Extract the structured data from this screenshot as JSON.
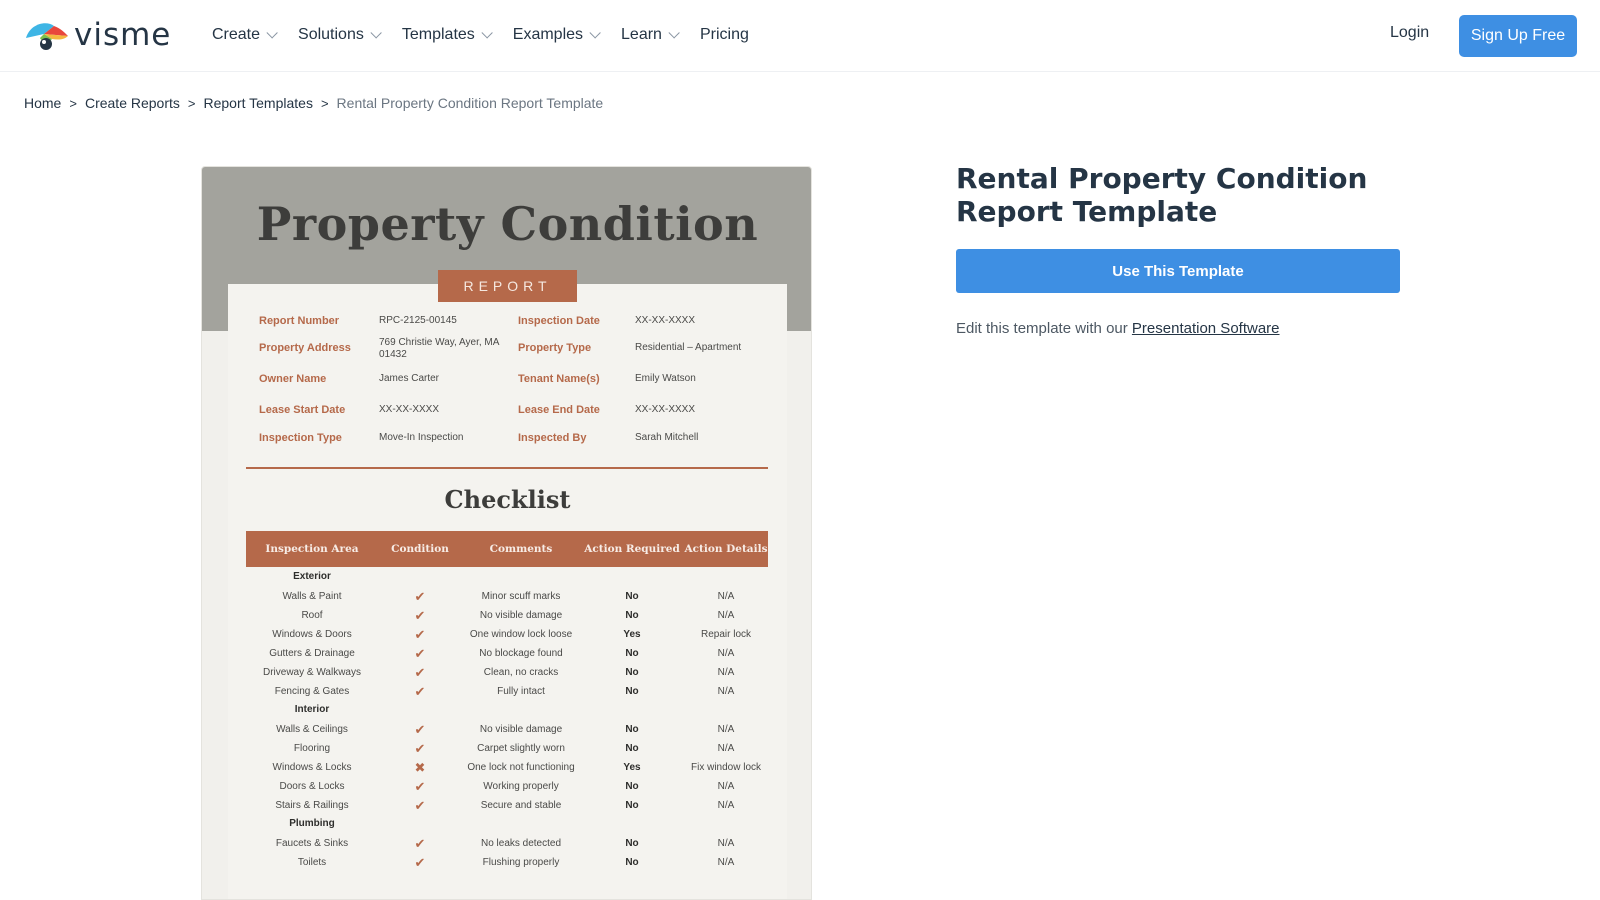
{
  "header": {
    "brand": "visme",
    "nav": [
      {
        "label": "Create",
        "dropdown": true
      },
      {
        "label": "Solutions",
        "dropdown": true
      },
      {
        "label": "Templates",
        "dropdown": true
      },
      {
        "label": "Examples",
        "dropdown": true
      },
      {
        "label": "Learn",
        "dropdown": true
      },
      {
        "label": "Pricing",
        "dropdown": false
      }
    ],
    "login": "Login",
    "signup": "Sign Up Free"
  },
  "breadcrumb": [
    {
      "label": "Home"
    },
    {
      "label": "Create Reports"
    },
    {
      "label": "Report Templates"
    },
    {
      "label": "Rental Property Condition Report Template"
    }
  ],
  "breadcrumb_separator": ">",
  "preview": {
    "title": "Property Condition",
    "tag": "REPORT",
    "info": [
      {
        "label": "Report Number",
        "value": "RPC-2125-00145"
      },
      {
        "label": "Inspection Date",
        "value": "XX-XX-XXXX"
      },
      {
        "label": "Property Address",
        "value": "769 Christie Way, Ayer, MA 01432"
      },
      {
        "label": "Property Type",
        "value": "Residential – Apartment"
      },
      {
        "label": "Owner Name",
        "value": "James Carter"
      },
      {
        "label": "Tenant Name(s)",
        "value": "Emily Watson"
      },
      {
        "label": "Lease Start Date",
        "value": "XX-XX-XXXX"
      },
      {
        "label": "Lease End Date",
        "value": "XX-XX-XXXX"
      },
      {
        "label": "Inspection Type",
        "value": "Move-In Inspection"
      },
      {
        "label": "Inspected By",
        "value": "Sarah Mitchell"
      }
    ],
    "checklist_title": "Checklist",
    "columns": [
      "Inspection Area",
      "Condition",
      "Comments",
      "Action Required",
      "Action Details"
    ],
    "sections": [
      {
        "name": "Exterior",
        "rows": [
          {
            "area": "Walls & Paint",
            "ok": true,
            "comment": "Minor scuff marks",
            "action": "No",
            "details": "N/A"
          },
          {
            "area": "Roof",
            "ok": true,
            "comment": "No visible damage",
            "action": "No",
            "details": "N/A"
          },
          {
            "area": "Windows & Doors",
            "ok": true,
            "comment": "One window lock loose",
            "action": "Yes",
            "details": "Repair lock"
          },
          {
            "area": "Gutters & Drainage",
            "ok": true,
            "comment": "No blockage found",
            "action": "No",
            "details": "N/A"
          },
          {
            "area": "Driveway & Walkways",
            "ok": true,
            "comment": "Clean, no cracks",
            "action": "No",
            "details": "N/A"
          },
          {
            "area": "Fencing & Gates",
            "ok": true,
            "comment": "Fully intact",
            "action": "No",
            "details": "N/A"
          }
        ]
      },
      {
        "name": "Interior",
        "rows": [
          {
            "area": "Walls & Ceilings",
            "ok": true,
            "comment": "No visible damage",
            "action": "No",
            "details": "N/A"
          },
          {
            "area": "Flooring",
            "ok": true,
            "comment": "Carpet slightly worn",
            "action": "No",
            "details": "N/A"
          },
          {
            "area": "Windows & Locks",
            "ok": false,
            "comment": "One lock not functioning",
            "action": "Yes",
            "details": "Fix window lock"
          },
          {
            "area": "Doors & Locks",
            "ok": true,
            "comment": "Working properly",
            "action": "No",
            "details": "N/A"
          },
          {
            "area": "Stairs & Railings",
            "ok": true,
            "comment": "Secure and stable",
            "action": "No",
            "details": "N/A"
          }
        ]
      },
      {
        "name": "Plumbing",
        "rows": [
          {
            "area": "Faucets & Sinks",
            "ok": true,
            "comment": "No leaks detected",
            "action": "No",
            "details": "N/A"
          },
          {
            "area": "Toilets",
            "ok": true,
            "comment": "Flushing properly",
            "action": "No",
            "details": "N/A"
          }
        ]
      }
    ]
  },
  "side": {
    "title": "Rental Property Condition Report Template",
    "use_button": "Use This Template",
    "edit_prefix": "Edit this template with our",
    "edit_link": "Presentation Software"
  },
  "colors": {
    "accent": "#3e8fe3",
    "doc_rust": "#b5694a",
    "doc_band": "#a3a39d",
    "text_dark": "#253545"
  }
}
